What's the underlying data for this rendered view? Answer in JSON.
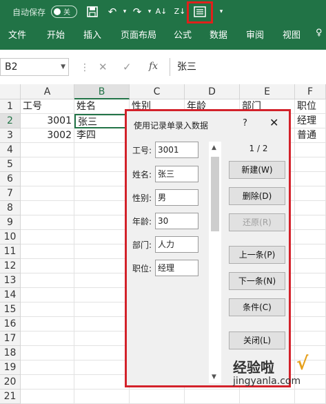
{
  "qat": {
    "autosave_label": "自动保存",
    "autosave_state": "关"
  },
  "ribbon": {
    "tabs": [
      "文件",
      "开始",
      "插入",
      "页面布局",
      "公式",
      "数据",
      "审阅",
      "视图"
    ]
  },
  "formula_bar": {
    "name_box": "B2",
    "fx": "fx",
    "content": "张三"
  },
  "sheet": {
    "columns": [
      "A",
      "B",
      "C",
      "D",
      "E",
      "F"
    ],
    "rows": [
      "1",
      "2",
      "3",
      "4",
      "5",
      "6",
      "7",
      "8",
      "9",
      "10",
      "11",
      "12",
      "13",
      "14",
      "15",
      "16",
      "17",
      "18",
      "19",
      "20",
      "21"
    ],
    "row1": [
      "工号",
      "姓名",
      "性别",
      "年龄",
      "部门",
      "职位"
    ],
    "row2": [
      "3001",
      "张三",
      "经理"
    ],
    "row3": [
      "3002",
      "李四",
      "普通"
    ]
  },
  "dialog": {
    "title": "使用记录单录入数据",
    "help": "?",
    "close": "✕",
    "fields": [
      {
        "label": "工号:",
        "value": "3001"
      },
      {
        "label": "姓名:",
        "value": "张三"
      },
      {
        "label": "性别:",
        "value": "男"
      },
      {
        "label": "年龄:",
        "value": "30"
      },
      {
        "label": "部门:",
        "value": "人力"
      },
      {
        "label": "职位:",
        "value": "经理"
      }
    ],
    "counter": "1 / 2",
    "buttons": {
      "new": "新建(W)",
      "delete": "删除(D)",
      "restore": "还原(R)",
      "prev": "上一条(P)",
      "next": "下一条(N)",
      "criteria": "条件(C)",
      "close": "关闭(L)"
    }
  },
  "watermark": {
    "line1": "经验啦",
    "line2": "jingyanla.com"
  }
}
